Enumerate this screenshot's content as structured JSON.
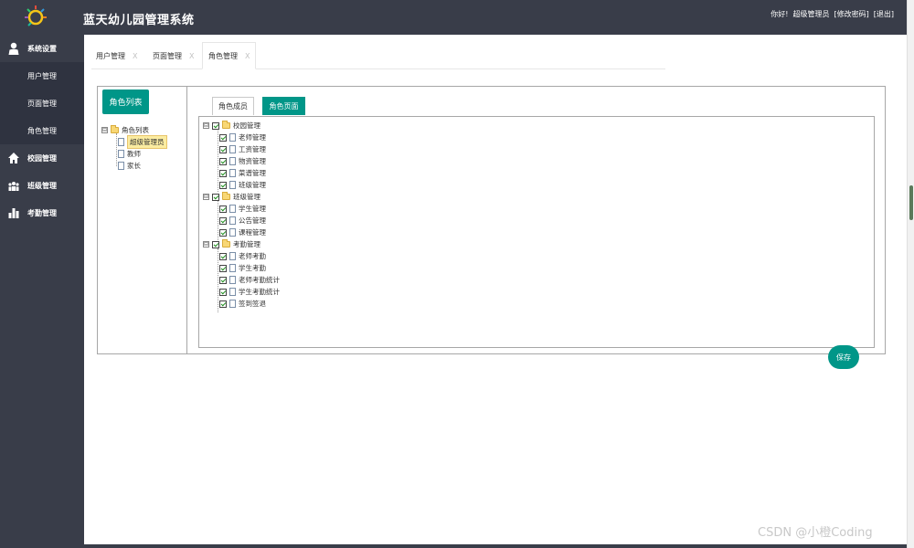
{
  "header": {
    "title": "蓝天幼儿园管理系统",
    "greeting": "你好!",
    "username": "超级管理员",
    "change_password": "[修改密码]",
    "logout": "[退出]"
  },
  "sidebar": {
    "groups": [
      {
        "label": "系统设置",
        "icon": "person-icon"
      },
      {
        "label": "校园管理",
        "icon": "home-icon"
      },
      {
        "label": "班级管理",
        "icon": "group-icon"
      },
      {
        "label": "考勤管理",
        "icon": "bar-chart-icon"
      }
    ],
    "sub_items": [
      "用户管理",
      "页面管理",
      "角色管理"
    ]
  },
  "tabs": [
    {
      "label": "用户管理",
      "close": "X"
    },
    {
      "label": "页面管理",
      "close": "X"
    },
    {
      "label": "角色管理",
      "close": "X"
    }
  ],
  "role_panel": {
    "button": "角色列表",
    "root": "角色列表",
    "roles": [
      "超级管理员",
      "教师",
      "家长"
    ],
    "expander": "⊟"
  },
  "perm_panel": {
    "tab_members": "角色成员",
    "tab_pages": "角色页面",
    "groups": [
      {
        "label": "校园管理",
        "children": [
          "老师管理",
          "工资管理",
          "物资管理",
          "菜谱管理",
          "班级管理"
        ]
      },
      {
        "label": "班级管理",
        "children": [
          "学生管理",
          "公告管理",
          "课程管理"
        ]
      },
      {
        "label": "考勤管理",
        "children": [
          "老师考勤",
          "学生考勤",
          "老师考勤统计",
          "学生考勤统计",
          "签到签退"
        ]
      }
    ],
    "save": "保存"
  },
  "watermark": "CSDN @小橙Coding",
  "colors": {
    "dark": "#393d49",
    "accent": "#009688"
  }
}
